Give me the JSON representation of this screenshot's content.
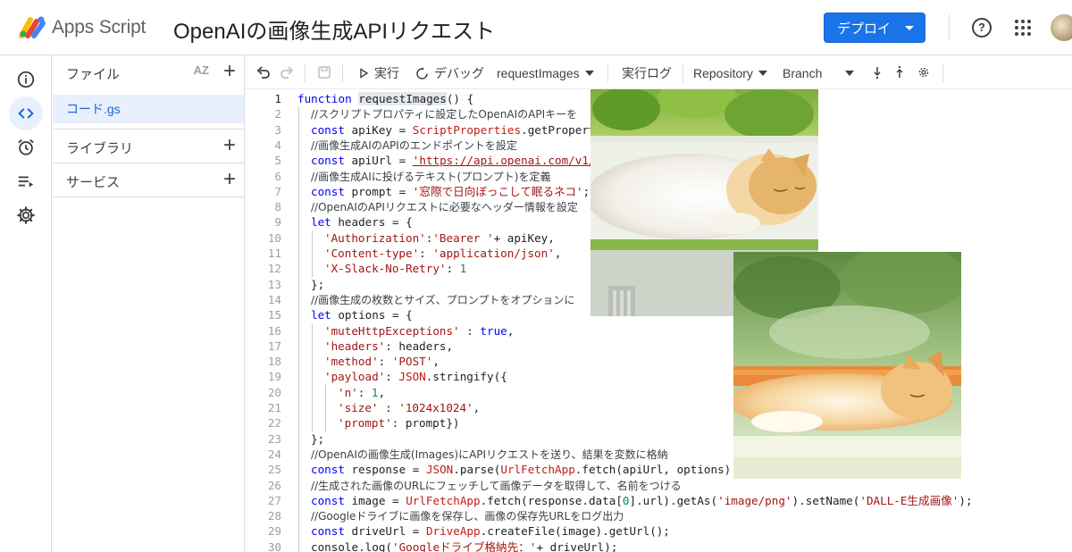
{
  "header": {
    "app_name": "Apps Script",
    "project_title": "OpenAIの画像生成APIリクエスト",
    "deploy_label": "デプロイ"
  },
  "files_panel": {
    "files_label": "ファイル",
    "sort_label": "AZ",
    "file_name": "コード.gs",
    "libraries_label": "ライブラリ",
    "services_label": "サービス"
  },
  "toolbar": {
    "run_label": "実行",
    "debug_label": "デバッグ",
    "function_select": "requestImages",
    "log_label": "実行ログ",
    "repository_label": "Repository",
    "branch_label": "Branch"
  },
  "editor": {
    "current_line": 1,
    "lines": [
      {
        "n": "1",
        "text": "function requestImages() {"
      },
      {
        "n": "2",
        "text": "//スクリプトプロパティに設定したOpenAIのAPIキーを"
      },
      {
        "n": "3",
        "text": "const apiKey = ScriptProperties.getPropert"
      },
      {
        "n": "4",
        "text": "//画像生成AIのAPIのエンドポイントを設定"
      },
      {
        "n": "5",
        "text": "const apiUrl = 'https://api.openai.com/v1/"
      },
      {
        "n": "6",
        "text": "//画像生成AIに投げるテキスト(プロンプト)を定義"
      },
      {
        "n": "7",
        "text": "const prompt = '窓際で日向ぼっこして眠るネコ';"
      },
      {
        "n": "8",
        "text": "//OpenAIのAPIリクエストに必要なヘッダー情報を設定"
      },
      {
        "n": "9",
        "text": "let headers = {"
      },
      {
        "n": "10",
        "text": "'Authorization':'Bearer '+ apiKey,"
      },
      {
        "n": "11",
        "text": "'Content-type': 'application/json',"
      },
      {
        "n": "12",
        "text": "'X-Slack-No-Retry': 1"
      },
      {
        "n": "13",
        "text": "};"
      },
      {
        "n": "14",
        "text": "//画像生成の枚数とサイズ、プロンプトをオプションに"
      },
      {
        "n": "15",
        "text": "let options = {"
      },
      {
        "n": "16",
        "text": "'muteHttpExceptions' : true,"
      },
      {
        "n": "17",
        "text": "'headers': headers,"
      },
      {
        "n": "18",
        "text": "'method': 'POST',"
      },
      {
        "n": "19",
        "text": "'payload': JSON.stringify({"
      },
      {
        "n": "20",
        "text": "'n': 1,"
      },
      {
        "n": "21",
        "text": "'size' : '1024x1024',"
      },
      {
        "n": "22",
        "text": "'prompt': prompt})"
      },
      {
        "n": "23",
        "text": "};"
      },
      {
        "n": "24",
        "text": "//OpenAIの画像生成(Images)にAPIリクエストを送り、結果を変数に格納"
      },
      {
        "n": "25",
        "text": "const response = JSON.parse(UrlFetchApp.fetch(apiUrl, options).g"
      },
      {
        "n": "26",
        "text": "//生成された画像のURLにフェッチして画像データを取得して、名前をつける"
      },
      {
        "n": "27",
        "text": "const image = UrlFetchApp.fetch(response.data[0].url).getAs('image/png').setName('DALL-E生成画像');"
      },
      {
        "n": "28",
        "text": "//Googleドライブに画像を保存し、画像の保存先URLをログ出力"
      },
      {
        "n": "29",
        "text": "const driveUrl = DriveApp.createFile(image).getUrl();"
      },
      {
        "n": "30",
        "text": "console.log('Googleドライブ格納先：'+ driveUrl);"
      }
    ]
  },
  "colors": {
    "accent": "#1a73e8",
    "keyword": "#0000ff",
    "string": "#a31515",
    "number": "#098658",
    "selection": "#e8f0fe"
  },
  "icons": [
    "apps-script-logo",
    "help-icon",
    "apps-grid-icon",
    "avatar",
    "info-icon",
    "code-icon",
    "alarm-icon",
    "executions-icon",
    "settings-icon",
    "sort-az-icon",
    "plus-icon",
    "undo-icon",
    "redo-icon",
    "save-icon",
    "run-icon",
    "debug-icon",
    "step-over-icon",
    "step-into-icon",
    "step-out-icon",
    "gear-icon"
  ]
}
